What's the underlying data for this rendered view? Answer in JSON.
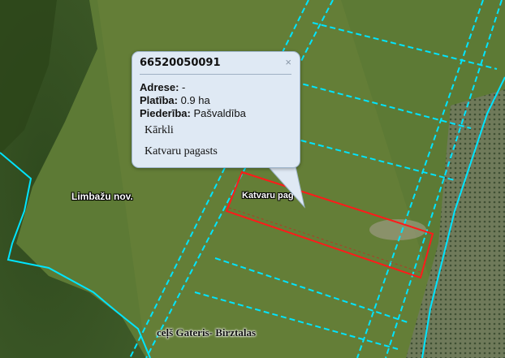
{
  "popup": {
    "title": "66520050091",
    "close": "×",
    "address_label": "Adrese:",
    "address_value": "-",
    "area_label": "Platība:",
    "area_value": "0.9 ha",
    "owner_label": "Piederība:",
    "owner_value": "Pašvaldība",
    "place": "Kārkli",
    "parish": "Katvaru pagasts"
  },
  "labels": {
    "municipality": "Limbažu nov.",
    "parcel_parish": "Katvaru pag",
    "road": "ceļš Gateris- Birztalas"
  },
  "colors": {
    "parcel_boundary": "#00e5ff",
    "municipal_boundary": "#00e5ff",
    "highlight": "#ff1a1a",
    "popup_background": "#dfe9f4"
  }
}
